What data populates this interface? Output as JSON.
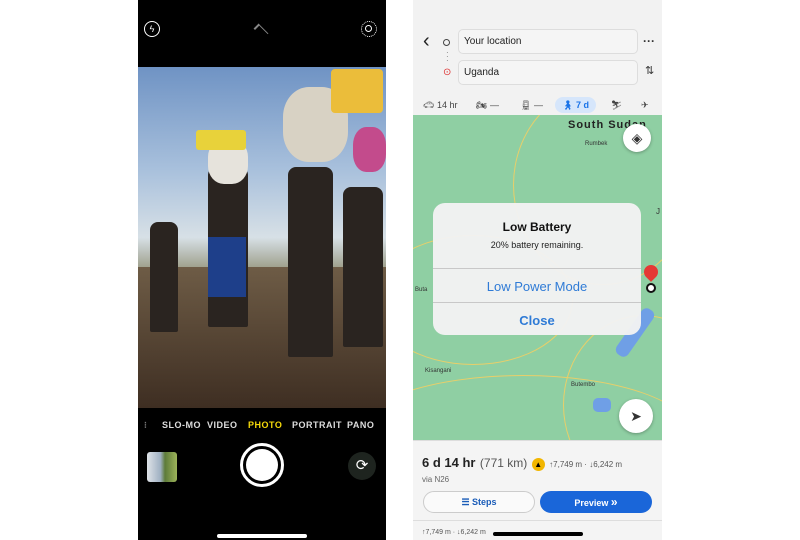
{
  "camera": {
    "modes": [
      "SLO-MO",
      "VIDEO",
      "PHOTO",
      "PORTRAIT",
      "PANO"
    ],
    "active_mode": "PHOTO",
    "active_color": "#f5d90a",
    "icons": [
      "flash-icon",
      "chevron-up-icon",
      "live-photo-icon",
      "camera-flip-icon"
    ]
  },
  "maps": {
    "origin": "Your location",
    "destination": "Uganda",
    "travel_modes": [
      {
        "icon": "car-icon",
        "label": "14 hr"
      },
      {
        "icon": "motorcycle-icon",
        "label": "—"
      },
      {
        "icon": "transit-icon",
        "label": "—"
      },
      {
        "icon": "walk-icon",
        "label": "7 d",
        "active": true
      },
      {
        "icon": "ride-icon",
        "label": ""
      },
      {
        "icon": "flight-icon",
        "label": ""
      }
    ],
    "map_labels": {
      "country": "South Sudan",
      "rumbek": "Rumbek",
      "buta": "Buta",
      "kisangani": "Kisangani",
      "butembo": "Butembo",
      "j": "J"
    },
    "dialog": {
      "title": "Low Battery",
      "message": "20% battery remaining.",
      "low_power": "Low Power Mode",
      "close": "Close"
    },
    "route": {
      "duration": "6 d 14 hr",
      "distance": "(771 km)",
      "elevation": "↑7,749 m · ↓6,242 m",
      "via": "via N26",
      "steps": "Steps",
      "preview": "Preview",
      "elevation2": "↑7,749 m · ↓6,242 m"
    },
    "accent": "#1a73e8"
  }
}
